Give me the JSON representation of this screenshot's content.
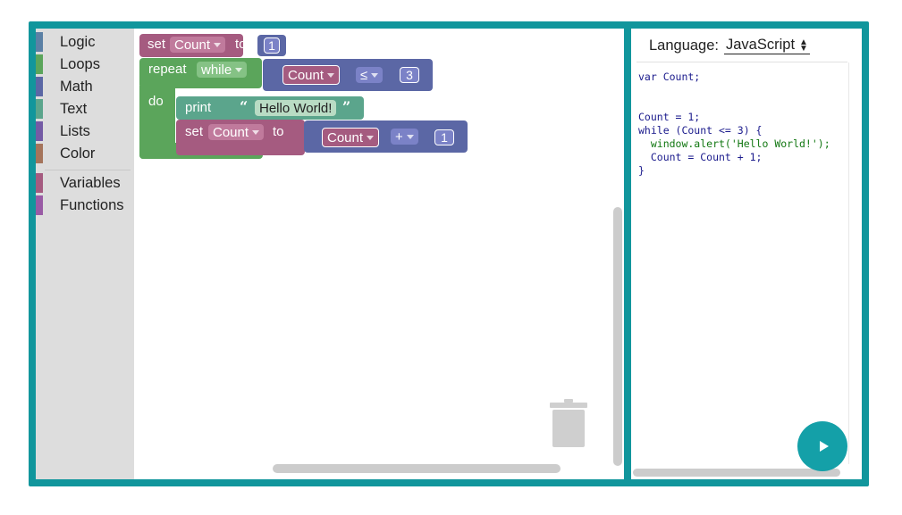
{
  "toolbox": {
    "categories": [
      {
        "label": "Logic",
        "color": "#5b80a5"
      },
      {
        "label": "Loops",
        "color": "#5ba55b"
      },
      {
        "label": "Math",
        "color": "#5b67a5"
      },
      {
        "label": "Text",
        "color": "#5ba58c"
      },
      {
        "label": "Lists",
        "color": "#745ba5"
      },
      {
        "label": "Color",
        "color": "#a5745b"
      },
      {
        "label": "Variables",
        "color": "#a55b80"
      },
      {
        "label": "Functions",
        "color": "#995ba5"
      }
    ]
  },
  "workspace": {
    "blocks": {
      "set1": {
        "kw_set": "set",
        "var": "Count",
        "kw_to": "to",
        "value": "1"
      },
      "repeat": {
        "kw_repeat": "repeat",
        "mode": "while",
        "kw_do": "do"
      },
      "compare": {
        "var": "Count",
        "op": "≤",
        "value": "3"
      },
      "print": {
        "kw_print": "print",
        "quote_open": "“",
        "text": "Hello World!",
        "quote_close": "”"
      },
      "set2": {
        "kw_set": "set",
        "var": "Count",
        "kw_to": "to"
      },
      "arith": {
        "var": "Count",
        "op": "+",
        "value": "1"
      }
    },
    "colors": {
      "variables": "#a55b80",
      "loops": "#5ba55b",
      "math": "#5b67a5",
      "text": "#5ba58c"
    },
    "trash_icon": "trash-can-icon"
  },
  "code_panel": {
    "language_label": "Language:",
    "language_value": "JavaScript",
    "run_icon": "play-icon",
    "lines": [
      "var Count;",
      "",
      "",
      "Count = 1;",
      "while (Count <= 3) {",
      "  window.alert('Hello World!');",
      "  Count = Count + 1;",
      "}"
    ],
    "accent": "#14a0a8"
  }
}
